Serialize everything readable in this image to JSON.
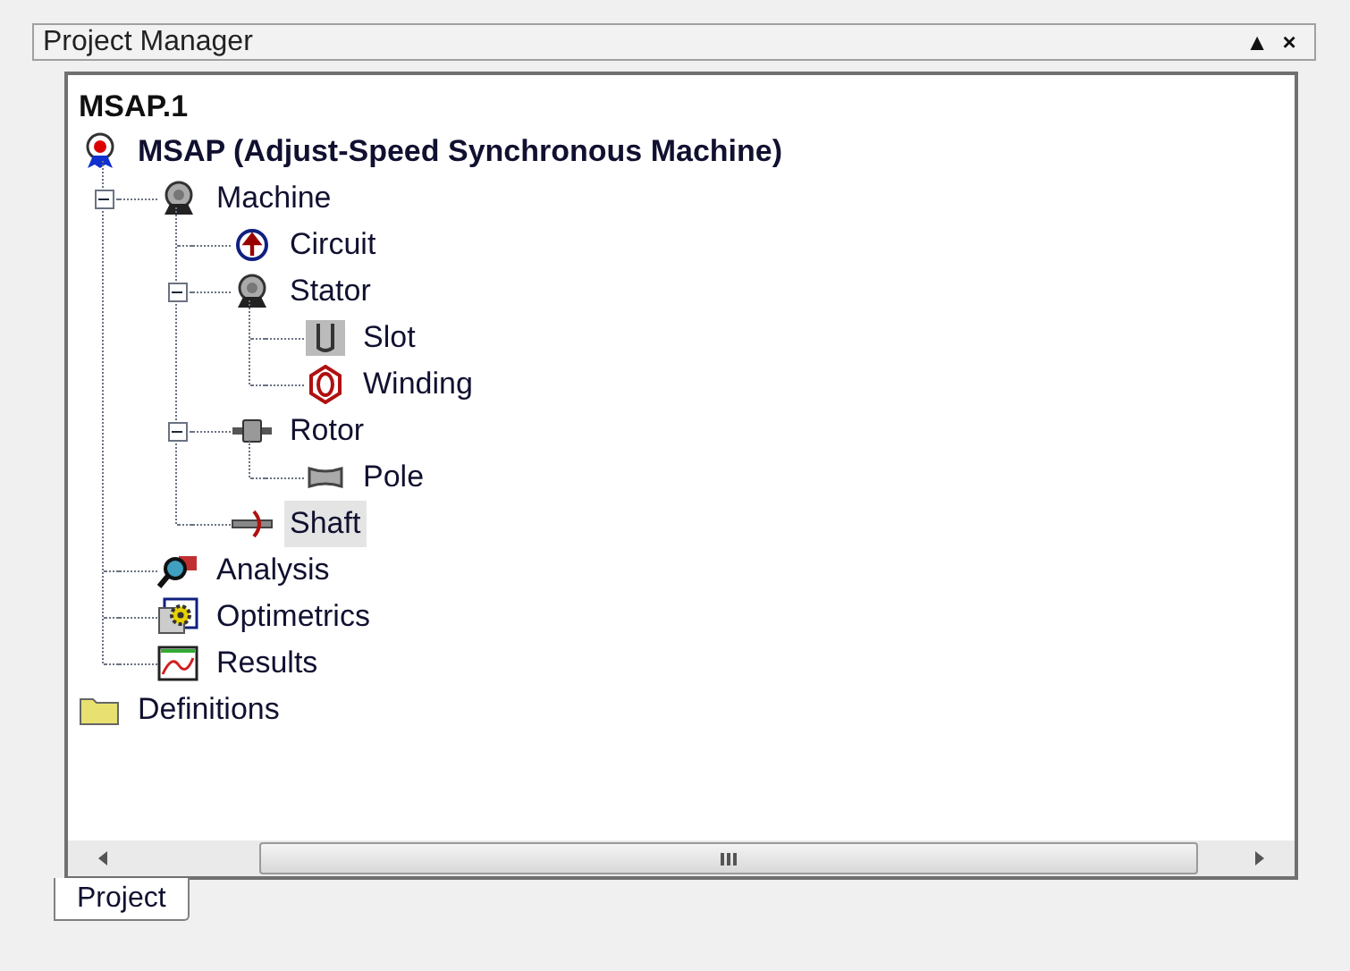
{
  "panel": {
    "title": "Project Manager",
    "buttons": [
      "▲",
      "×"
    ]
  },
  "tree": {
    "title": "MSAP.1",
    "items": [
      {
        "label": "MSAP (Adjust-Speed Synchronous Machine)",
        "kind": "design",
        "bold": true,
        "selected": false,
        "children": [
          {
            "label": "Machine",
            "kind": "machine",
            "selected": false,
            "expanded": true,
            "children": [
              {
                "label": "Circuit",
                "kind": "circuit",
                "selected": false
              },
              {
                "label": "Stator",
                "kind": "stator",
                "selected": false,
                "expanded": true,
                "children": [
                  {
                    "label": "Slot",
                    "kind": "slot",
                    "selected": false
                  },
                  {
                    "label": "Winding",
                    "kind": "winding",
                    "selected": false
                  }
                ]
              },
              {
                "label": "Rotor",
                "kind": "rotor",
                "selected": false,
                "expanded": true,
                "children": [
                  {
                    "label": "Pole",
                    "kind": "pole",
                    "selected": false
                  }
                ]
              },
              {
                "label": "Shaft",
                "kind": "shaft",
                "selected": true
              }
            ]
          },
          {
            "label": "Analysis",
            "kind": "analysis",
            "selected": false
          },
          {
            "label": "Optimetrics",
            "kind": "optimetrics",
            "selected": false
          },
          {
            "label": "Results",
            "kind": "results",
            "selected": false
          }
        ]
      },
      {
        "label": "Definitions",
        "kind": "definitions",
        "selected": false
      }
    ]
  },
  "tabs": [
    {
      "label": "Project",
      "selected": true
    }
  ]
}
